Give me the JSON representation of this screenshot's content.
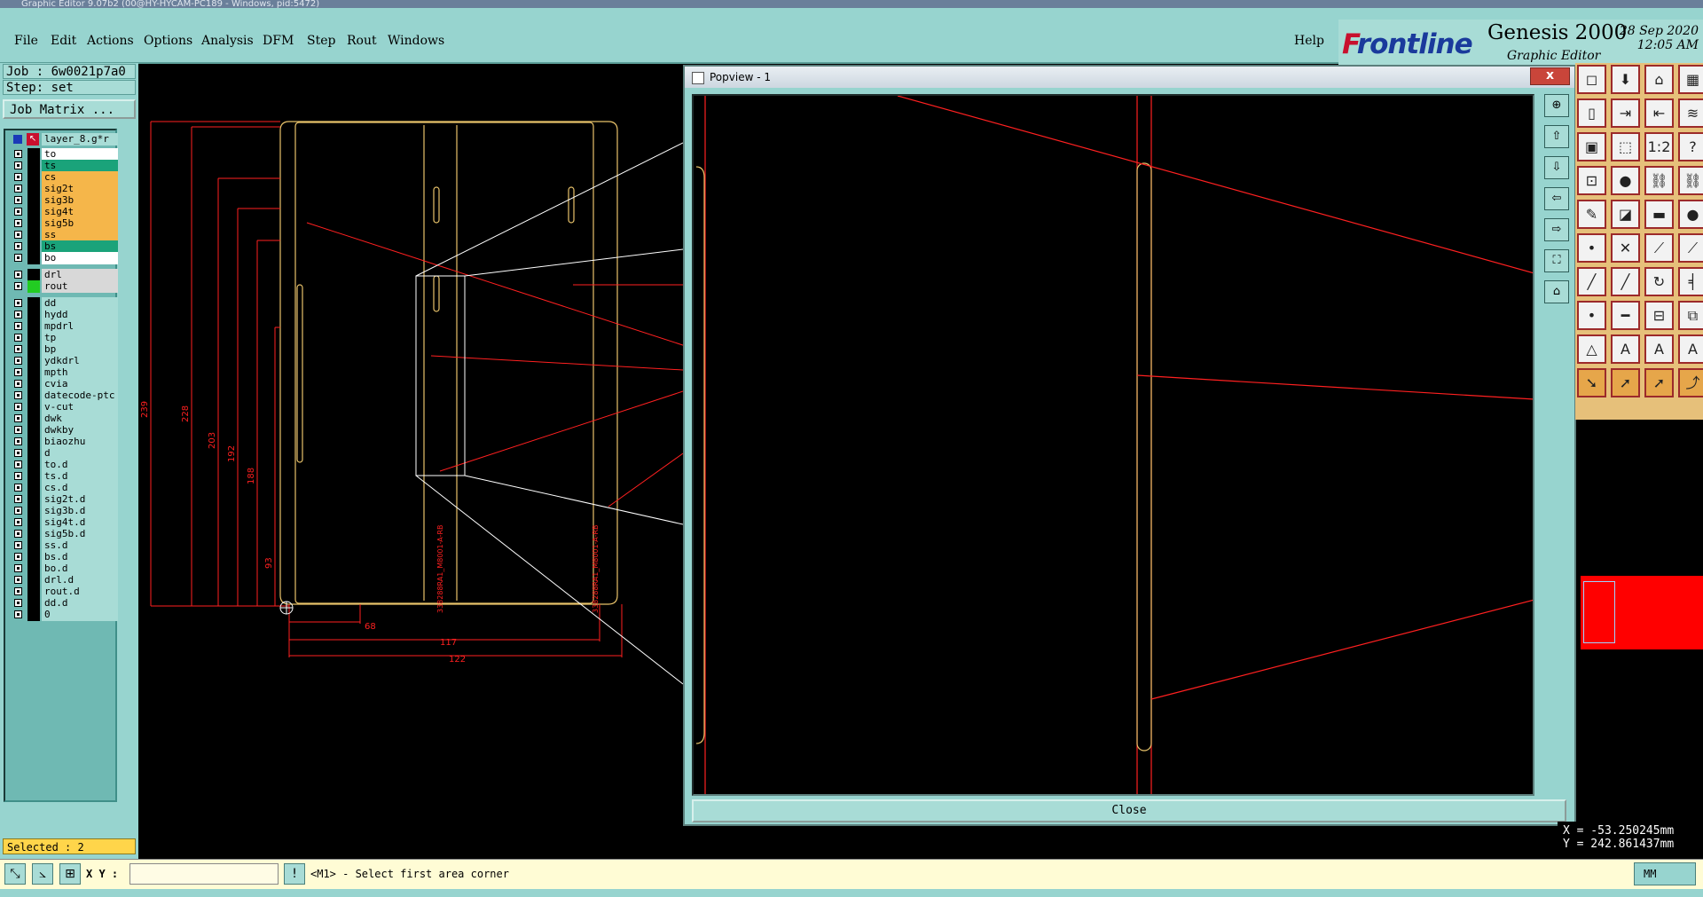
{
  "window_title": "Graphic Editor 9.07b2 (00@HY-HYCAM-PC189 - Windows, pid:5472)",
  "menu": {
    "items": [
      "File",
      "Edit",
      "Actions",
      "Options",
      "Analysis",
      "DFM",
      "Step",
      "Rout",
      "Windows"
    ],
    "help": "Help"
  },
  "brand": {
    "logo_f": "F",
    "logo_rest": "rontline",
    "product": "Genesis 2000",
    "subtitle": "Graphic Editor",
    "date": "28 Sep 2020",
    "time": "12:05 AM"
  },
  "job": {
    "job_label": "Job : 6w0021p7a0",
    "step_label": "Step: set",
    "matrix_button": "Job Matrix ..."
  },
  "layers": {
    "header": "layer_8.g*r",
    "items": [
      {
        "name": "to",
        "color": "#ffffff"
      },
      {
        "name": "ts",
        "color": "#1aa37a"
      },
      {
        "name": "cs",
        "color": "#f5b64a"
      },
      {
        "name": "sig2t",
        "color": "#f5b64a"
      },
      {
        "name": "sig3b",
        "color": "#f5b64a"
      },
      {
        "name": "sig4t",
        "color": "#f5b64a"
      },
      {
        "name": "sig5b",
        "color": "#f5b64a"
      },
      {
        "name": "ss",
        "color": "#f5b64a"
      },
      {
        "name": "bs",
        "color": "#1aa37a"
      },
      {
        "name": "bo",
        "color": "#ffffff"
      },
      {
        "name": "drl",
        "color": "#d8d8d8"
      },
      {
        "name": "rout",
        "color": "#d8d8d8"
      },
      {
        "name": "dd",
        "color": "#a8dcd6"
      },
      {
        "name": "hydd",
        "color": "#a8dcd6"
      },
      {
        "name": "mpdrl",
        "color": "#a8dcd6"
      },
      {
        "name": "tp",
        "color": "#a8dcd6"
      },
      {
        "name": "bp",
        "color": "#a8dcd6"
      },
      {
        "name": "ydkdrl",
        "color": "#a8dcd6"
      },
      {
        "name": "mpth",
        "color": "#a8dcd6"
      },
      {
        "name": "cvia",
        "color": "#a8dcd6"
      },
      {
        "name": "datecode-ptc",
        "color": "#a8dcd6"
      },
      {
        "name": "v-cut",
        "color": "#a8dcd6"
      },
      {
        "name": "dwk",
        "color": "#a8dcd6"
      },
      {
        "name": "dwkby",
        "color": "#a8dcd6"
      },
      {
        "name": "biaozhu",
        "color": "#a8dcd6"
      },
      {
        "name": "d",
        "color": "#a8dcd6"
      },
      {
        "name": "to.d",
        "color": "#a8dcd6"
      },
      {
        "name": "ts.d",
        "color": "#a8dcd6"
      },
      {
        "name": "cs.d",
        "color": "#a8dcd6"
      },
      {
        "name": "sig2t.d",
        "color": "#a8dcd6"
      },
      {
        "name": "sig3b.d",
        "color": "#a8dcd6"
      },
      {
        "name": "sig4t.d",
        "color": "#a8dcd6"
      },
      {
        "name": "sig5b.d",
        "color": "#a8dcd6"
      },
      {
        "name": "ss.d",
        "color": "#a8dcd6"
      },
      {
        "name": "bs.d",
        "color": "#a8dcd6"
      },
      {
        "name": "bo.d",
        "color": "#a8dcd6"
      },
      {
        "name": "drl.d",
        "color": "#a8dcd6"
      },
      {
        "name": "rout.d",
        "color": "#a8dcd6"
      },
      {
        "name": "dd.d",
        "color": "#a8dcd6"
      },
      {
        "name": "0",
        "color": "#a8dcd6"
      }
    ]
  },
  "selected_label": "Selected : 2",
  "status": {
    "xy_label": "X Y :",
    "xy_value": "",
    "prompt": "<M1> - Select first area corner",
    "units": "MM"
  },
  "coords": {
    "x": "X = -53.250245mm",
    "y": "Y = 242.861437mm"
  },
  "popview": {
    "title": "Popview - 1",
    "close_x": "x",
    "close_button": "Close"
  },
  "dimensions": {
    "v": [
      "239",
      "228",
      "203",
      "192",
      "188",
      "93"
    ],
    "h": [
      "68",
      "117",
      "122"
    ],
    "rotated_text": [
      "338288RA1_M8001-A-RB",
      "338288RA1_M8001-A-RB"
    ]
  },
  "colors": {
    "accent_teal": "#97d4cf",
    "drawing_red": "#ff2020",
    "outline_yellow": "#e8c26a"
  }
}
